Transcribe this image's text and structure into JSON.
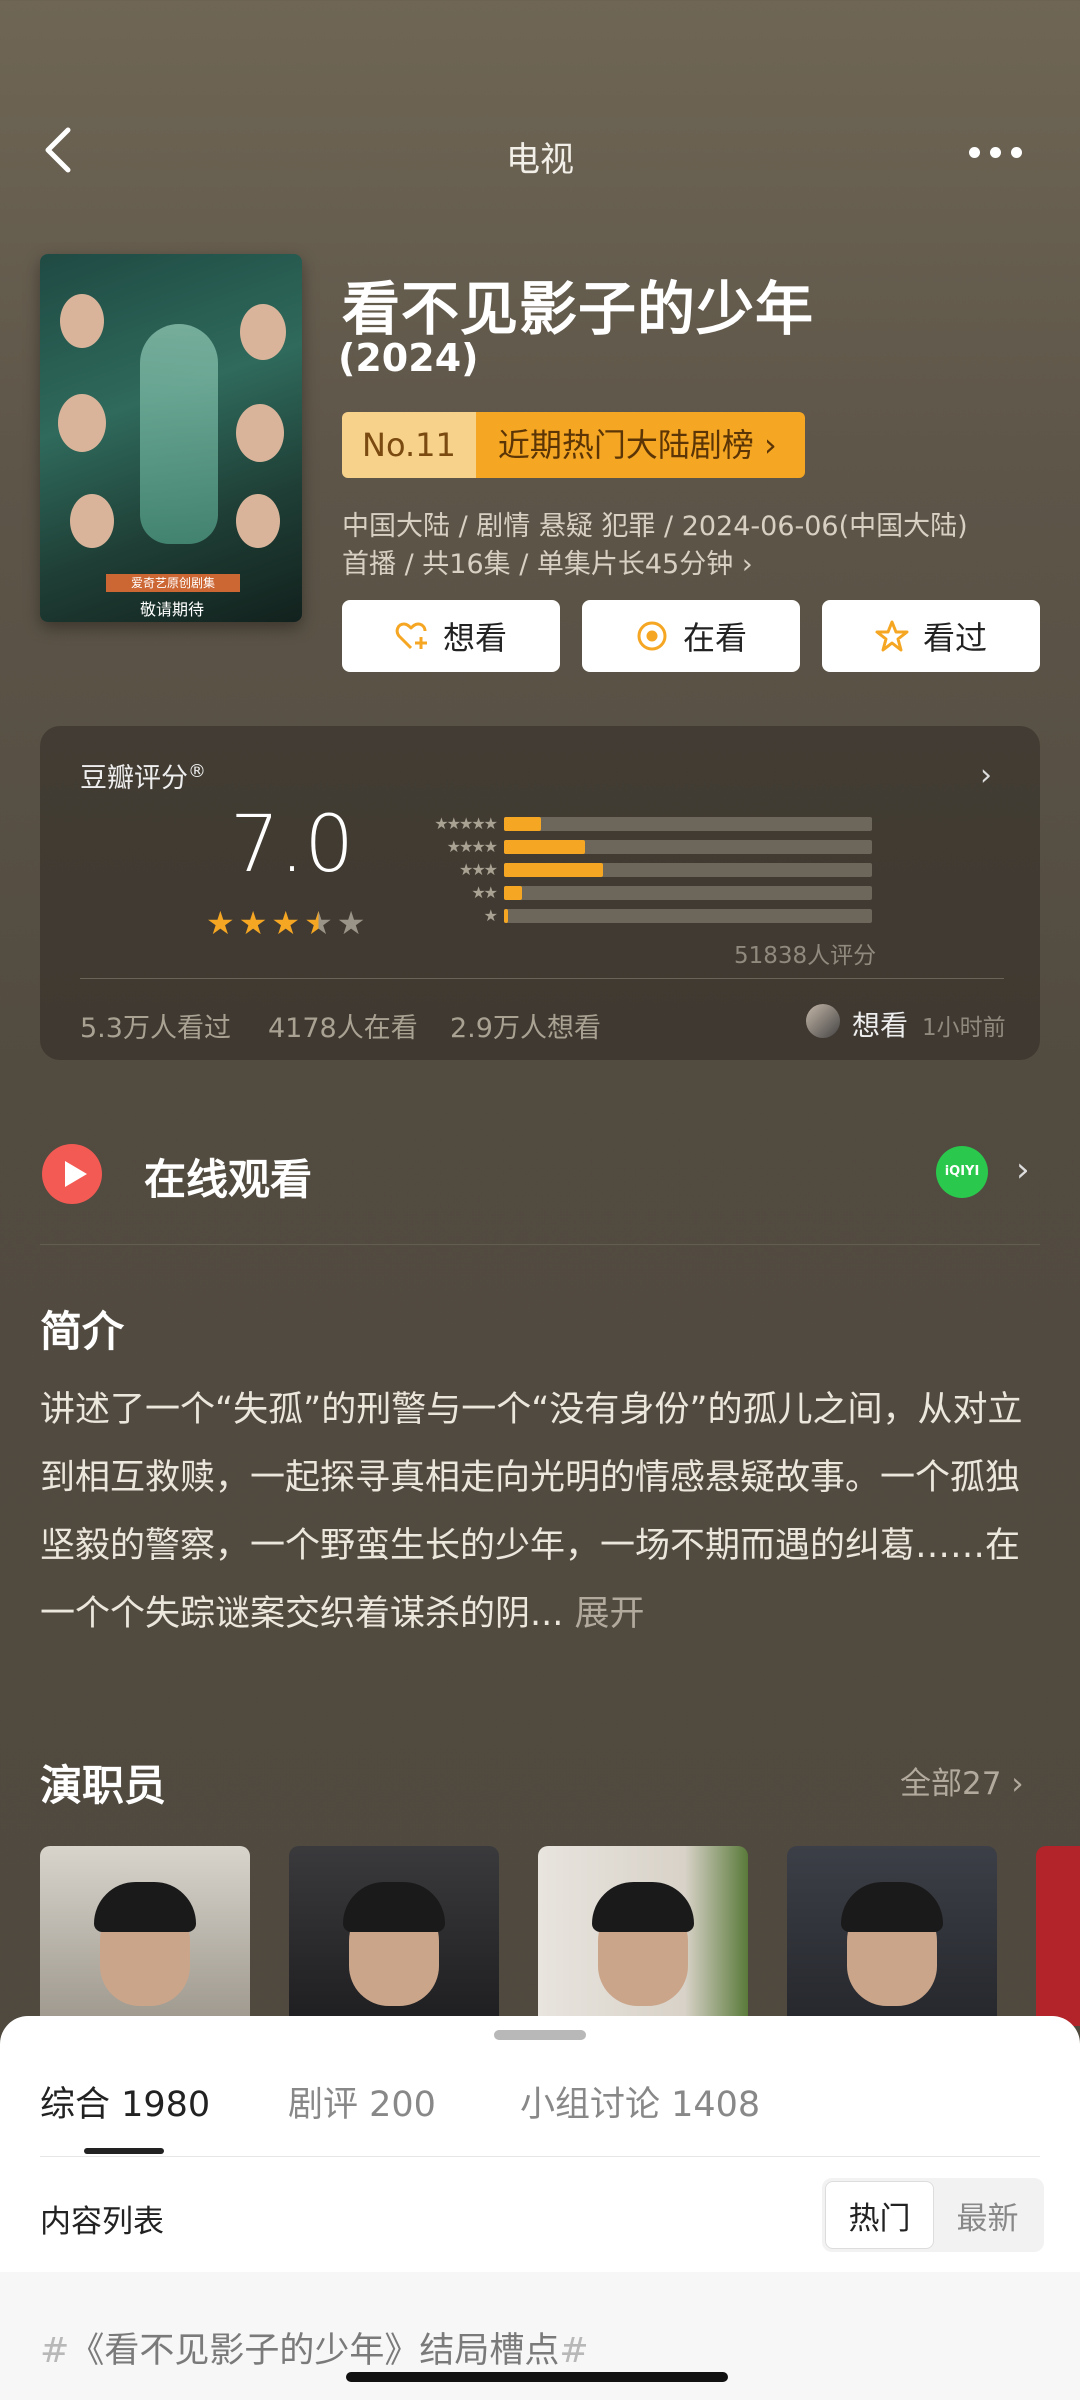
{
  "nav": {
    "title": "电视",
    "back_icon": "chevron-left-icon",
    "more_icon": "more-horizontal-icon"
  },
  "show": {
    "title": "看不见影子的少年",
    "year": "(2024)",
    "rank": {
      "no": "No.11",
      "label": "近期热门大陆剧榜 ›"
    },
    "meta_line1": "中国大陆 / 剧情 悬疑 犯罪 / 2024-06-06(中国大陆)",
    "meta_line2": "首播 / 共16集 / 单集片长45分钟 ›",
    "poster": {
      "line1": "爱奇艺原创剧集",
      "line2": "敬请期待"
    }
  },
  "actions": [
    {
      "label": "想看",
      "icon": "heart-plus-icon"
    },
    {
      "label": "在看",
      "icon": "target-circle-icon"
    },
    {
      "label": "看过",
      "icon": "star-outline-icon"
    }
  ],
  "rating": {
    "title": "豆瓣评分",
    "title_mark": "®",
    "score": "7.0",
    "stars": 3.5,
    "distribution": [
      {
        "stars": 5,
        "fraction": 0.1
      },
      {
        "stars": 4,
        "fraction": 0.22
      },
      {
        "stars": 3,
        "fraction": 0.27
      },
      {
        "stars": 2,
        "fraction": 0.05
      },
      {
        "stars": 1,
        "fraction": 0.01
      }
    ],
    "count_label": "51838人评分",
    "stats": [
      "5.3万人看过",
      "4178人在看",
      "2.9万人想看"
    ],
    "friend_action": "想看",
    "friend_time": "1小时前",
    "accent_color": "#f5a623"
  },
  "online": {
    "title": "在线观看",
    "platform_icon": "iqiyi-logo-icon",
    "platform_text": "iQIYI"
  },
  "intro": {
    "heading": "简介",
    "body": "讲述了一个“失孤”的刑警与一个“没有身份”的孤儿之间，从对立到相互救赎，一起探寻真相走向光明的情感悬疑故事。一个孤独坚毅的警察，一个野蛮生长的少年，一场不期而遇的纠葛……在一个个失踪谜案交织着谋杀的阴...",
    "more": " 展开"
  },
  "cast": {
    "heading": "演职员",
    "all_label": "全部27 ›"
  },
  "sheet": {
    "tabs": [
      "综合 1980",
      "剧评 200",
      "小组讨论 1408"
    ],
    "active_tab": 0,
    "list_label": "内容列表",
    "sort_options": [
      "热门",
      "最新"
    ],
    "sort_selected": "热门",
    "topic_hash": "#",
    "topic_text": "《看不见影子的少年》结局槽点"
  }
}
